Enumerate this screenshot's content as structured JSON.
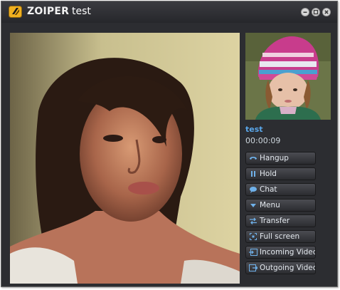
{
  "app": {
    "brand": "ZOIPER",
    "title": "test"
  },
  "window_controls": {
    "icons": [
      "minimize-icon",
      "restore-icon",
      "close-icon"
    ]
  },
  "contact": {
    "name": "test",
    "call_duration": "00:00:09"
  },
  "actions": {
    "hangup": "Hangup",
    "hold": "Hold",
    "chat": "Chat",
    "menu": "Menu",
    "transfer": "Transfer",
    "fullscreen": "Full screen",
    "incoming_video": "Incoming Video",
    "outgoing_video": "Outgoing Video"
  },
  "colors": {
    "accent": "#5aa7ea",
    "window_bg": "#2c2d31",
    "button_icon": "#6fb1ea"
  }
}
